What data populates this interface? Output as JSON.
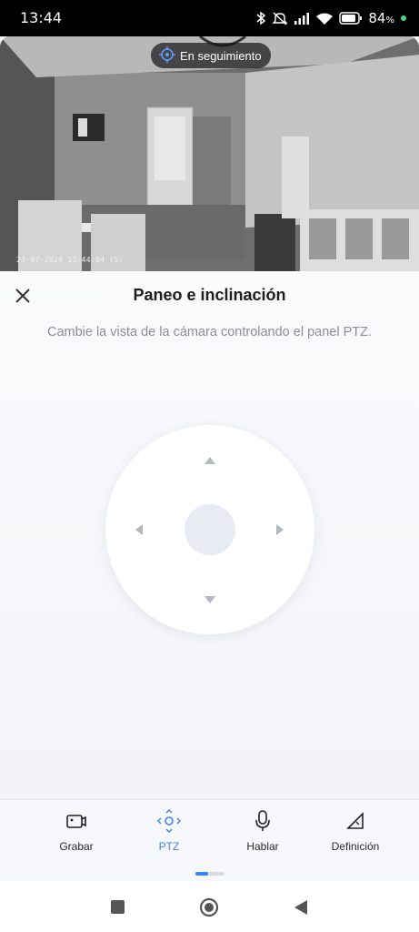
{
  "status_bar": {
    "time": "13:44",
    "battery_percent": "84",
    "battery_unit": "%",
    "icons": [
      "bluetooth-icon",
      "mute-icon",
      "signal-icon",
      "wifi-icon",
      "battery-icon"
    ]
  },
  "camera": {
    "tracking_label": "En seguimiento",
    "timestamp": "23-07-2024 13:44:04 (S)"
  },
  "panel": {
    "title": "Paneo e inclinación",
    "subtitle": "Cambie la vista de la cámara controlando el panel PTZ."
  },
  "toolbar": {
    "items": [
      {
        "label": "Grabar",
        "icon": "record-icon"
      },
      {
        "label": "PTZ",
        "icon": "ptz-icon",
        "active": true
      },
      {
        "label": "Hablar",
        "icon": "microphone-icon"
      },
      {
        "label": "Definición",
        "icon": "definition-icon"
      }
    ]
  },
  "colors": {
    "accent": "#3b82f6",
    "background": "#f3f5f9"
  }
}
